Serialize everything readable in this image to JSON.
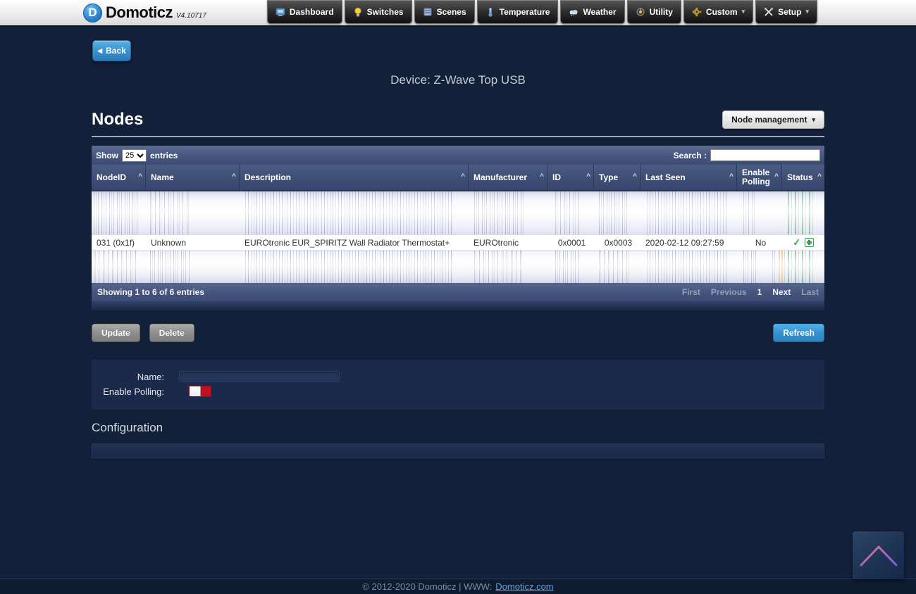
{
  "navbar": {
    "logo_text": "Domoticz",
    "version": "V4.10717",
    "items": [
      {
        "label": "Dashboard"
      },
      {
        "label": "Switches"
      },
      {
        "label": "Scenes"
      },
      {
        "label": "Temperature"
      },
      {
        "label": "Weather"
      },
      {
        "label": "Utility"
      },
      {
        "label": "Custom"
      },
      {
        "label": "Setup"
      }
    ]
  },
  "page": {
    "back_label": "Back",
    "title": "Device: Z-Wave Top USB",
    "section_title": "Nodes",
    "node_management_label": "Node management",
    "configuration_title": "Configuration"
  },
  "table": {
    "show_label": "Show",
    "page_length": "25",
    "entries_label": "entries",
    "search_label": "Search :",
    "search_value": "",
    "columns": [
      "NodeID",
      "Name",
      "Description",
      "Manufacturer",
      "ID",
      "Type",
      "Last Seen",
      "Enable Polling",
      "Status"
    ],
    "row": {
      "node_id": "031 (0x1f)",
      "name": "Unknown",
      "description": "EUROtronic EUR_SPIRITZ Wall Radiator Thermostat+",
      "manufacturer": "EUROtronic",
      "id": "0x0001",
      "type": "0x0003",
      "last_seen": "2020-02-12 09:27:59",
      "enable_polling": "No"
    },
    "info": "Showing 1 to 6 of 6 entries",
    "pagination": [
      "First",
      "Previous",
      "1",
      "Next",
      "Last"
    ]
  },
  "actions": {
    "update_label": "Update",
    "delete_label": "Delete",
    "refresh_label": "Refresh"
  },
  "form": {
    "name_label": "Name:",
    "name_value": "",
    "enable_polling_label": "Enable Polling:"
  },
  "footer": {
    "copyright": "© 2012-2020 Domoticz | WWW:",
    "link_label": "Domoticz.com"
  },
  "icons": {
    "caret_down": "▾",
    "sort_caret": "^",
    "back_arrow": "◀",
    "check": "✓"
  },
  "colors": {
    "body_background": "#132039",
    "brand_blue": "#2f86d6",
    "table_bar": "#46567e",
    "status_green": "#3bb05a",
    "toggle_red": "#c50e1f",
    "link_blue": "#55a7e2",
    "refresh_blue": "#3492d0",
    "chevron_pink": "#d46a9e"
  }
}
